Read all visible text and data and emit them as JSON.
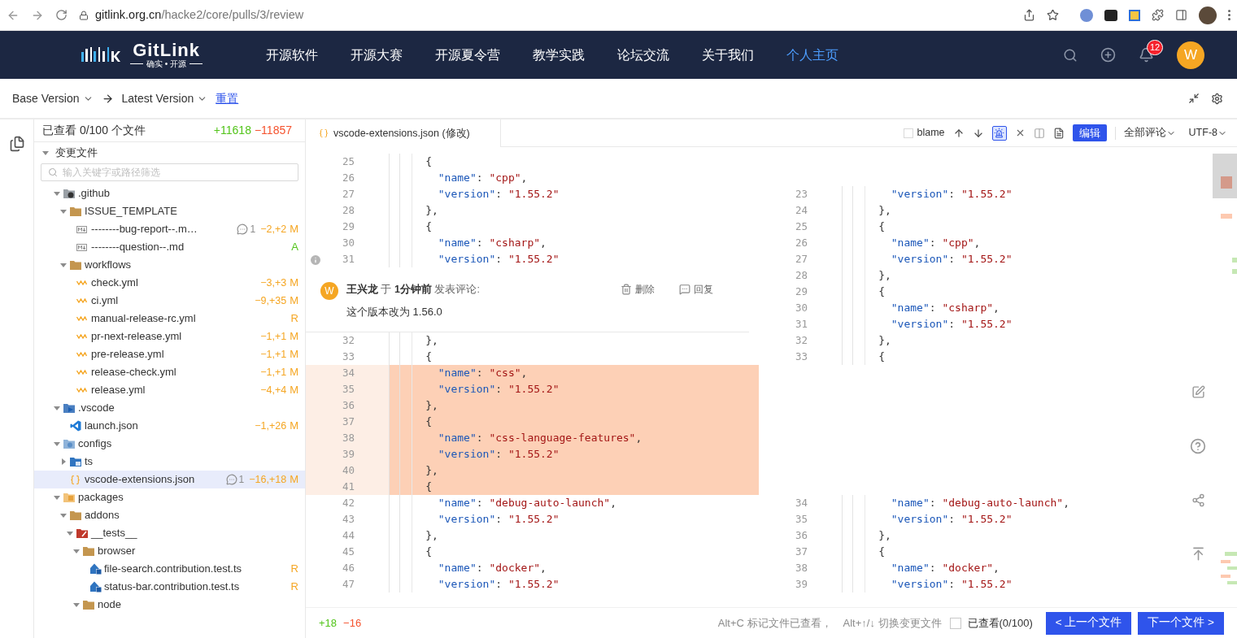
{
  "browser": {
    "url_host": "gitlink.org.cn",
    "url_path": "/hacke2/core/pulls/3/review"
  },
  "nav": {
    "logo": "GitLink",
    "tagline": "确实 • 开源",
    "items": [
      {
        "label": "开源软件",
        "selected": false
      },
      {
        "label": "开源大赛",
        "selected": false
      },
      {
        "label": "开源夏令营",
        "selected": false
      },
      {
        "label": "教学实践",
        "selected": false
      },
      {
        "label": "论坛交流",
        "selected": false
      },
      {
        "label": "关于我们",
        "selected": false
      },
      {
        "label": "个人主页",
        "selected": true
      }
    ],
    "notifications": "12",
    "avatar": "W"
  },
  "compare": {
    "base": "Base Version",
    "head": "Latest Version",
    "reset": "重置"
  },
  "files": {
    "viewed": "已查看 0/100 个文件",
    "added": "+11618",
    "removed": "−11857",
    "section": "变更文件",
    "section_expanded": true,
    "filter_placeholder": "输入关键字或路径筛选",
    "tree": [
      {
        "name": ".github",
        "kind": "github-folder",
        "expanded": true,
        "selected": false,
        "children": [
          {
            "name": "ISSUE_TEMPLATE",
            "kind": "folder",
            "expanded": true,
            "selected": false,
            "children": [
              {
                "name": "--------bug-report--.m…",
                "kind": "markdown",
                "selected": false,
                "comments": "1",
                "stat": "−2,+2",
                "status": "M",
                "color": "#f5a623"
              },
              {
                "name": "--------question--.md",
                "kind": "markdown",
                "selected": false,
                "status": "A",
                "color": "#52c41a"
              }
            ]
          },
          {
            "name": "workflows",
            "kind": "folder",
            "expanded": true,
            "selected": false,
            "children": [
              {
                "name": "check.yml",
                "kind": "yaml",
                "selected": false,
                "stat": "−3,+3",
                "status": "M",
                "color": "#f5a623"
              },
              {
                "name": "ci.yml",
                "kind": "yaml",
                "selected": false,
                "stat": "−9,+35",
                "status": "M",
                "color": "#f5a623"
              },
              {
                "name": "manual-release-rc.yml",
                "kind": "yaml",
                "selected": false,
                "status": "R",
                "color": "#f5a623"
              },
              {
                "name": "pr-next-release.yml",
                "kind": "yaml",
                "selected": false,
                "stat": "−1,+1",
                "status": "M",
                "color": "#f5a623"
              },
              {
                "name": "pre-release.yml",
                "kind": "yaml",
                "selected": false,
                "stat": "−1,+1",
                "status": "M",
                "color": "#f5a623"
              },
              {
                "name": "release-check.yml",
                "kind": "yaml",
                "selected": false,
                "stat": "−1,+1",
                "status": "M",
                "color": "#f5a623"
              },
              {
                "name": "release.yml",
                "kind": "yaml",
                "selected": false,
                "stat": "−4,+4",
                "status": "M",
                "color": "#f5a623"
              }
            ]
          }
        ]
      },
      {
        "name": ".vscode",
        "kind": "vscode-folder",
        "expanded": true,
        "selected": false,
        "children": [
          {
            "name": "launch.json",
            "kind": "vscode",
            "selected": false,
            "stat": "−1,+26",
            "status": "M",
            "color": "#f5a623"
          }
        ]
      },
      {
        "name": "configs",
        "kind": "config-folder",
        "expanded": true,
        "selected": false,
        "children": [
          {
            "name": "ts",
            "kind": "ts-folder",
            "expanded": false,
            "selected": false
          },
          {
            "name": "vscode-extensions.json",
            "kind": "json",
            "selected": true,
            "comments": "1",
            "stat": "−16,+18",
            "status": "M",
            "color": "#f5a623"
          }
        ]
      },
      {
        "name": "packages",
        "kind": "package-folder",
        "expanded": true,
        "selected": false,
        "children": [
          {
            "name": "addons",
            "kind": "folder",
            "expanded": true,
            "selected": false,
            "children": [
              {
                "name": "__tests__",
                "kind": "test-folder",
                "expanded": true,
                "selected": false,
                "children": [
                  {
                    "name": "browser",
                    "kind": "folder",
                    "expanded": true,
                    "selected": false,
                    "children": [
                      {
                        "name": "file-search.contribution.test.ts",
                        "kind": "ts",
                        "selected": false,
                        "status": "R",
                        "color": "#f5a623"
                      },
                      {
                        "name": "status-bar.contribution.test.ts",
                        "kind": "ts",
                        "selected": false,
                        "status": "R",
                        "color": "#f5a623"
                      }
                    ]
                  },
                  {
                    "name": "node",
                    "kind": "folder",
                    "expanded": true,
                    "selected": false
                  }
                ]
              }
            ]
          }
        ]
      }
    ]
  },
  "diff": {
    "tab": "vscode-extensions.json (修改)",
    "blame": {
      "label": "blame",
      "checked": false
    },
    "edit": "编辑",
    "comments_filter": "全部评论",
    "encoding": "UTF-8",
    "left": [
      {
        "kind": "line",
        "num": "25",
        "code": "     {",
        "removed": false
      },
      {
        "kind": "line",
        "num": "26",
        "code": "       \"name\": \"cpp\",",
        "removed": false
      },
      {
        "kind": "line",
        "num": "27",
        "code": "       \"version\": \"1.55.2\"",
        "removed": false
      },
      {
        "kind": "line",
        "num": "28",
        "code": "     },",
        "removed": false
      },
      {
        "kind": "line",
        "num": "29",
        "code": "     {",
        "removed": false
      },
      {
        "kind": "line",
        "num": "30",
        "code": "       \"name\": \"csharp\",",
        "removed": false
      },
      {
        "kind": "line",
        "num": "31",
        "code": "       \"version\": \"1.55.2\"",
        "removed": false
      },
      {
        "kind": "comment",
        "avatar": "W",
        "header": "**王兴龙** 于 **1分钟前** 发表评论:",
        "body": "这个版本改为 1.56.0",
        "delete": "删除",
        "reply": "回复"
      },
      {
        "kind": "line",
        "num": "32",
        "code": "     },",
        "removed": false
      },
      {
        "kind": "line",
        "num": "33",
        "code": "     {",
        "removed": false
      },
      {
        "kind": "line",
        "num": "34",
        "code": "       \"name\": \"css\",",
        "removed": true
      },
      {
        "kind": "line",
        "num": "35",
        "code": "       \"version\": \"1.55.2\"",
        "removed": true
      },
      {
        "kind": "line",
        "num": "36",
        "code": "     },",
        "removed": true
      },
      {
        "kind": "line",
        "num": "37",
        "code": "     {",
        "removed": true
      },
      {
        "kind": "line",
        "num": "38",
        "code": "       \"name\": \"css-language-features\",",
        "removed": true
      },
      {
        "kind": "line",
        "num": "39",
        "code": "       \"version\": \"1.55.2\"",
        "removed": true
      },
      {
        "kind": "line",
        "num": "40",
        "code": "     },",
        "removed": true
      },
      {
        "kind": "line",
        "num": "41",
        "code": "     {",
        "removed": true
      },
      {
        "kind": "line",
        "num": "42",
        "code": "       \"name\": \"debug-auto-launch\",",
        "removed": false
      },
      {
        "kind": "line",
        "num": "43",
        "code": "       \"version\": \"1.55.2\"",
        "removed": false
      },
      {
        "kind": "line",
        "num": "44",
        "code": "     },",
        "removed": false
      },
      {
        "kind": "line",
        "num": "45",
        "code": "     {",
        "removed": false
      },
      {
        "kind": "line",
        "num": "46",
        "code": "       \"name\": \"docker\",",
        "removed": false
      },
      {
        "kind": "line",
        "num": "47",
        "code": "       \"version\": \"1.55.2\"",
        "removed": false
      }
    ],
    "right": [
      {
        "kind": "spacer"
      },
      {
        "kind": "spacer"
      },
      {
        "kind": "line",
        "num": "23",
        "code": "       \"version\": \"1.55.2\"",
        "removed": false
      },
      {
        "kind": "line",
        "num": "24",
        "code": "     },",
        "removed": false
      },
      {
        "kind": "line",
        "num": "25",
        "code": "     {",
        "removed": false
      },
      {
        "kind": "line",
        "num": "26",
        "code": "       \"name\": \"cpp\",",
        "removed": false
      },
      {
        "kind": "line",
        "num": "27",
        "code": "       \"version\": \"1.55.2\"",
        "removed": false
      },
      {
        "kind": "line",
        "num": "28",
        "code": "     },",
        "removed": false
      },
      {
        "kind": "line",
        "num": "29",
        "code": "     {",
        "removed": false
      },
      {
        "kind": "line",
        "num": "30",
        "code": "       \"name\": \"csharp\",",
        "removed": false
      },
      {
        "kind": "line",
        "num": "31",
        "code": "       \"version\": \"1.55.2\"",
        "removed": false
      },
      {
        "kind": "line",
        "num": "32",
        "code": "     },",
        "removed": false
      },
      {
        "kind": "line",
        "num": "33",
        "code": "     {",
        "removed": false
      },
      {
        "kind": "spacer"
      },
      {
        "kind": "spacer"
      },
      {
        "kind": "spacer"
      },
      {
        "kind": "spacer"
      },
      {
        "kind": "spacer"
      },
      {
        "kind": "spacer"
      },
      {
        "kind": "spacer"
      },
      {
        "kind": "spacer"
      },
      {
        "kind": "line",
        "num": "34",
        "code": "       \"name\": \"debug-auto-launch\",",
        "removed": false
      },
      {
        "kind": "line",
        "num": "35",
        "code": "       \"version\": \"1.55.2\"",
        "removed": false
      },
      {
        "kind": "line",
        "num": "36",
        "code": "     },",
        "removed": false
      },
      {
        "kind": "line",
        "num": "37",
        "code": "     {",
        "removed": false
      },
      {
        "kind": "line",
        "num": "38",
        "code": "       \"name\": \"docker\",",
        "removed": false
      },
      {
        "kind": "line",
        "num": "39",
        "code": "       \"version\": \"1.55.2\"",
        "removed": false
      }
    ]
  },
  "footer": {
    "added": "+18",
    "removed": "−16",
    "hint_mark": "Alt+C 标记文件已查看，",
    "hint_switch": "Alt+↑/↓ 切换变更文件",
    "viewed": {
      "label": "已查看(0/100)",
      "checked": false
    },
    "prev": "< 上一个文件",
    "next": "下一个文件 >"
  }
}
